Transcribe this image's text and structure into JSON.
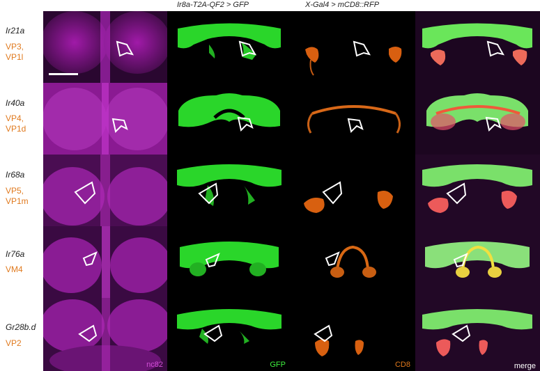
{
  "headers": {
    "gfp_column": "Ir8a-T2A-QF2 > GFP",
    "rfp_column": "X-Gal4 > mCD8::RFP"
  },
  "rows": [
    {
      "gene": "Ir21a",
      "glomeruli": [
        "VP3,",
        "VP1l"
      ]
    },
    {
      "gene": "Ir40a",
      "glomeruli": [
        "VP4,",
        "VP1d"
      ]
    },
    {
      "gene": "Ir68a",
      "glomeruli": [
        "VP5,",
        "VP1m"
      ]
    },
    {
      "gene": "Ir76a",
      "glomeruli": [
        "VM4"
      ]
    },
    {
      "gene": "Gr28b.d",
      "glomeruli": [
        "VP2"
      ]
    }
  ],
  "channel_labels": {
    "nc82": "nc82",
    "gfp": "GFP",
    "cd8": "CD8",
    "merge": "merge"
  },
  "colors": {
    "nc82": "#c21ec7",
    "gfp": "#2fe02f",
    "cd8": "#e06a10",
    "glomerulus_label": "#e07a1f",
    "outline": "#ffffff"
  }
}
